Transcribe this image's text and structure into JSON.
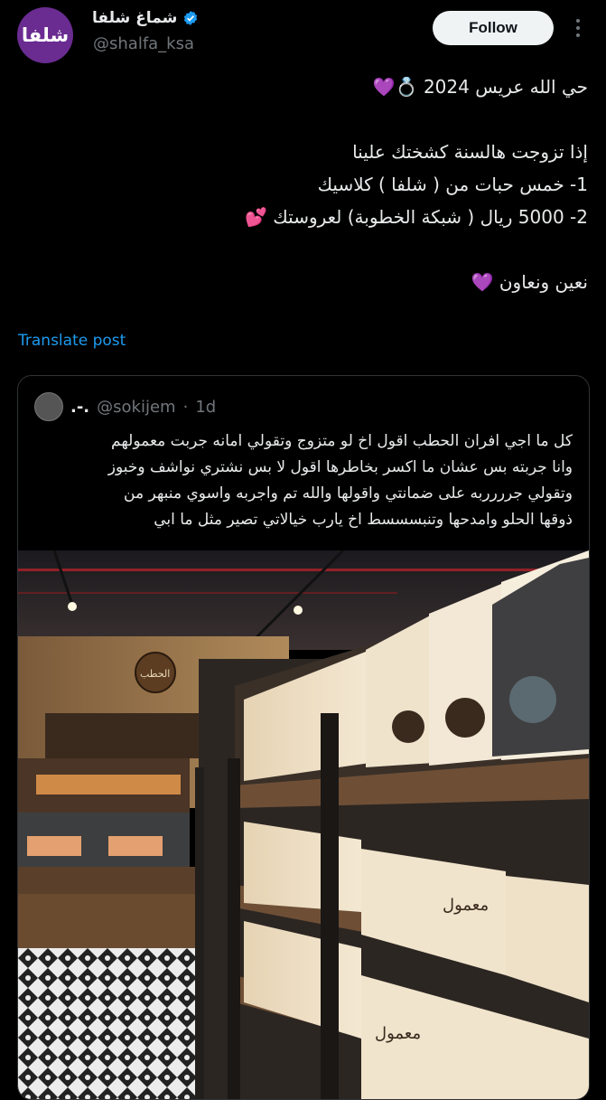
{
  "author": {
    "avatar_text": "شلفا",
    "display_name": "شماغ شلفا",
    "handle": "@shalfa_ksa",
    "follow_label": "Follow"
  },
  "tweet": {
    "lines": [
      "حي الله عريس 2024 💍💜",
      "",
      "إذا تزوجت هالسنة كشختك علينا",
      "1- خمس حبات من ( شلفا ) كلاسيك",
      "2- 5000 ريال ( شبكة الخطوبة) لعروستك 💕",
      "",
      "نعين ونعاون 💜"
    ],
    "translate_label": "Translate post"
  },
  "quote": {
    "name": ".-.",
    "handle": "@sokijem",
    "separator": "·",
    "time": "1d",
    "lines": [
      "كل ما اجي افران الحطب اقول اخ لو متزوج وتقولي امانه جربت معمولهم",
      "وانا جربته بس عشان ما اكسر بخاطرها اقول لا بس نشتري نواشف وخبوز",
      "وتقولي جرررربه على ضمانتي واقولها والله تم واجربه واسوي منبهر من",
      "ذوقها الحلو وامدحها وتنبسسسط اخ يارب خيالاتي تصير مثل ما ابي"
    ],
    "photo": {
      "box_label_1": "معمول",
      "box_label_2": "معمول",
      "brand": "الحطب"
    }
  },
  "colors": {
    "background": "#000000",
    "text": "#e7e9ea",
    "muted": "#71767b",
    "link": "#1d9bf0",
    "verified": "#1d9bf0",
    "avatar": "#6a2c91"
  }
}
